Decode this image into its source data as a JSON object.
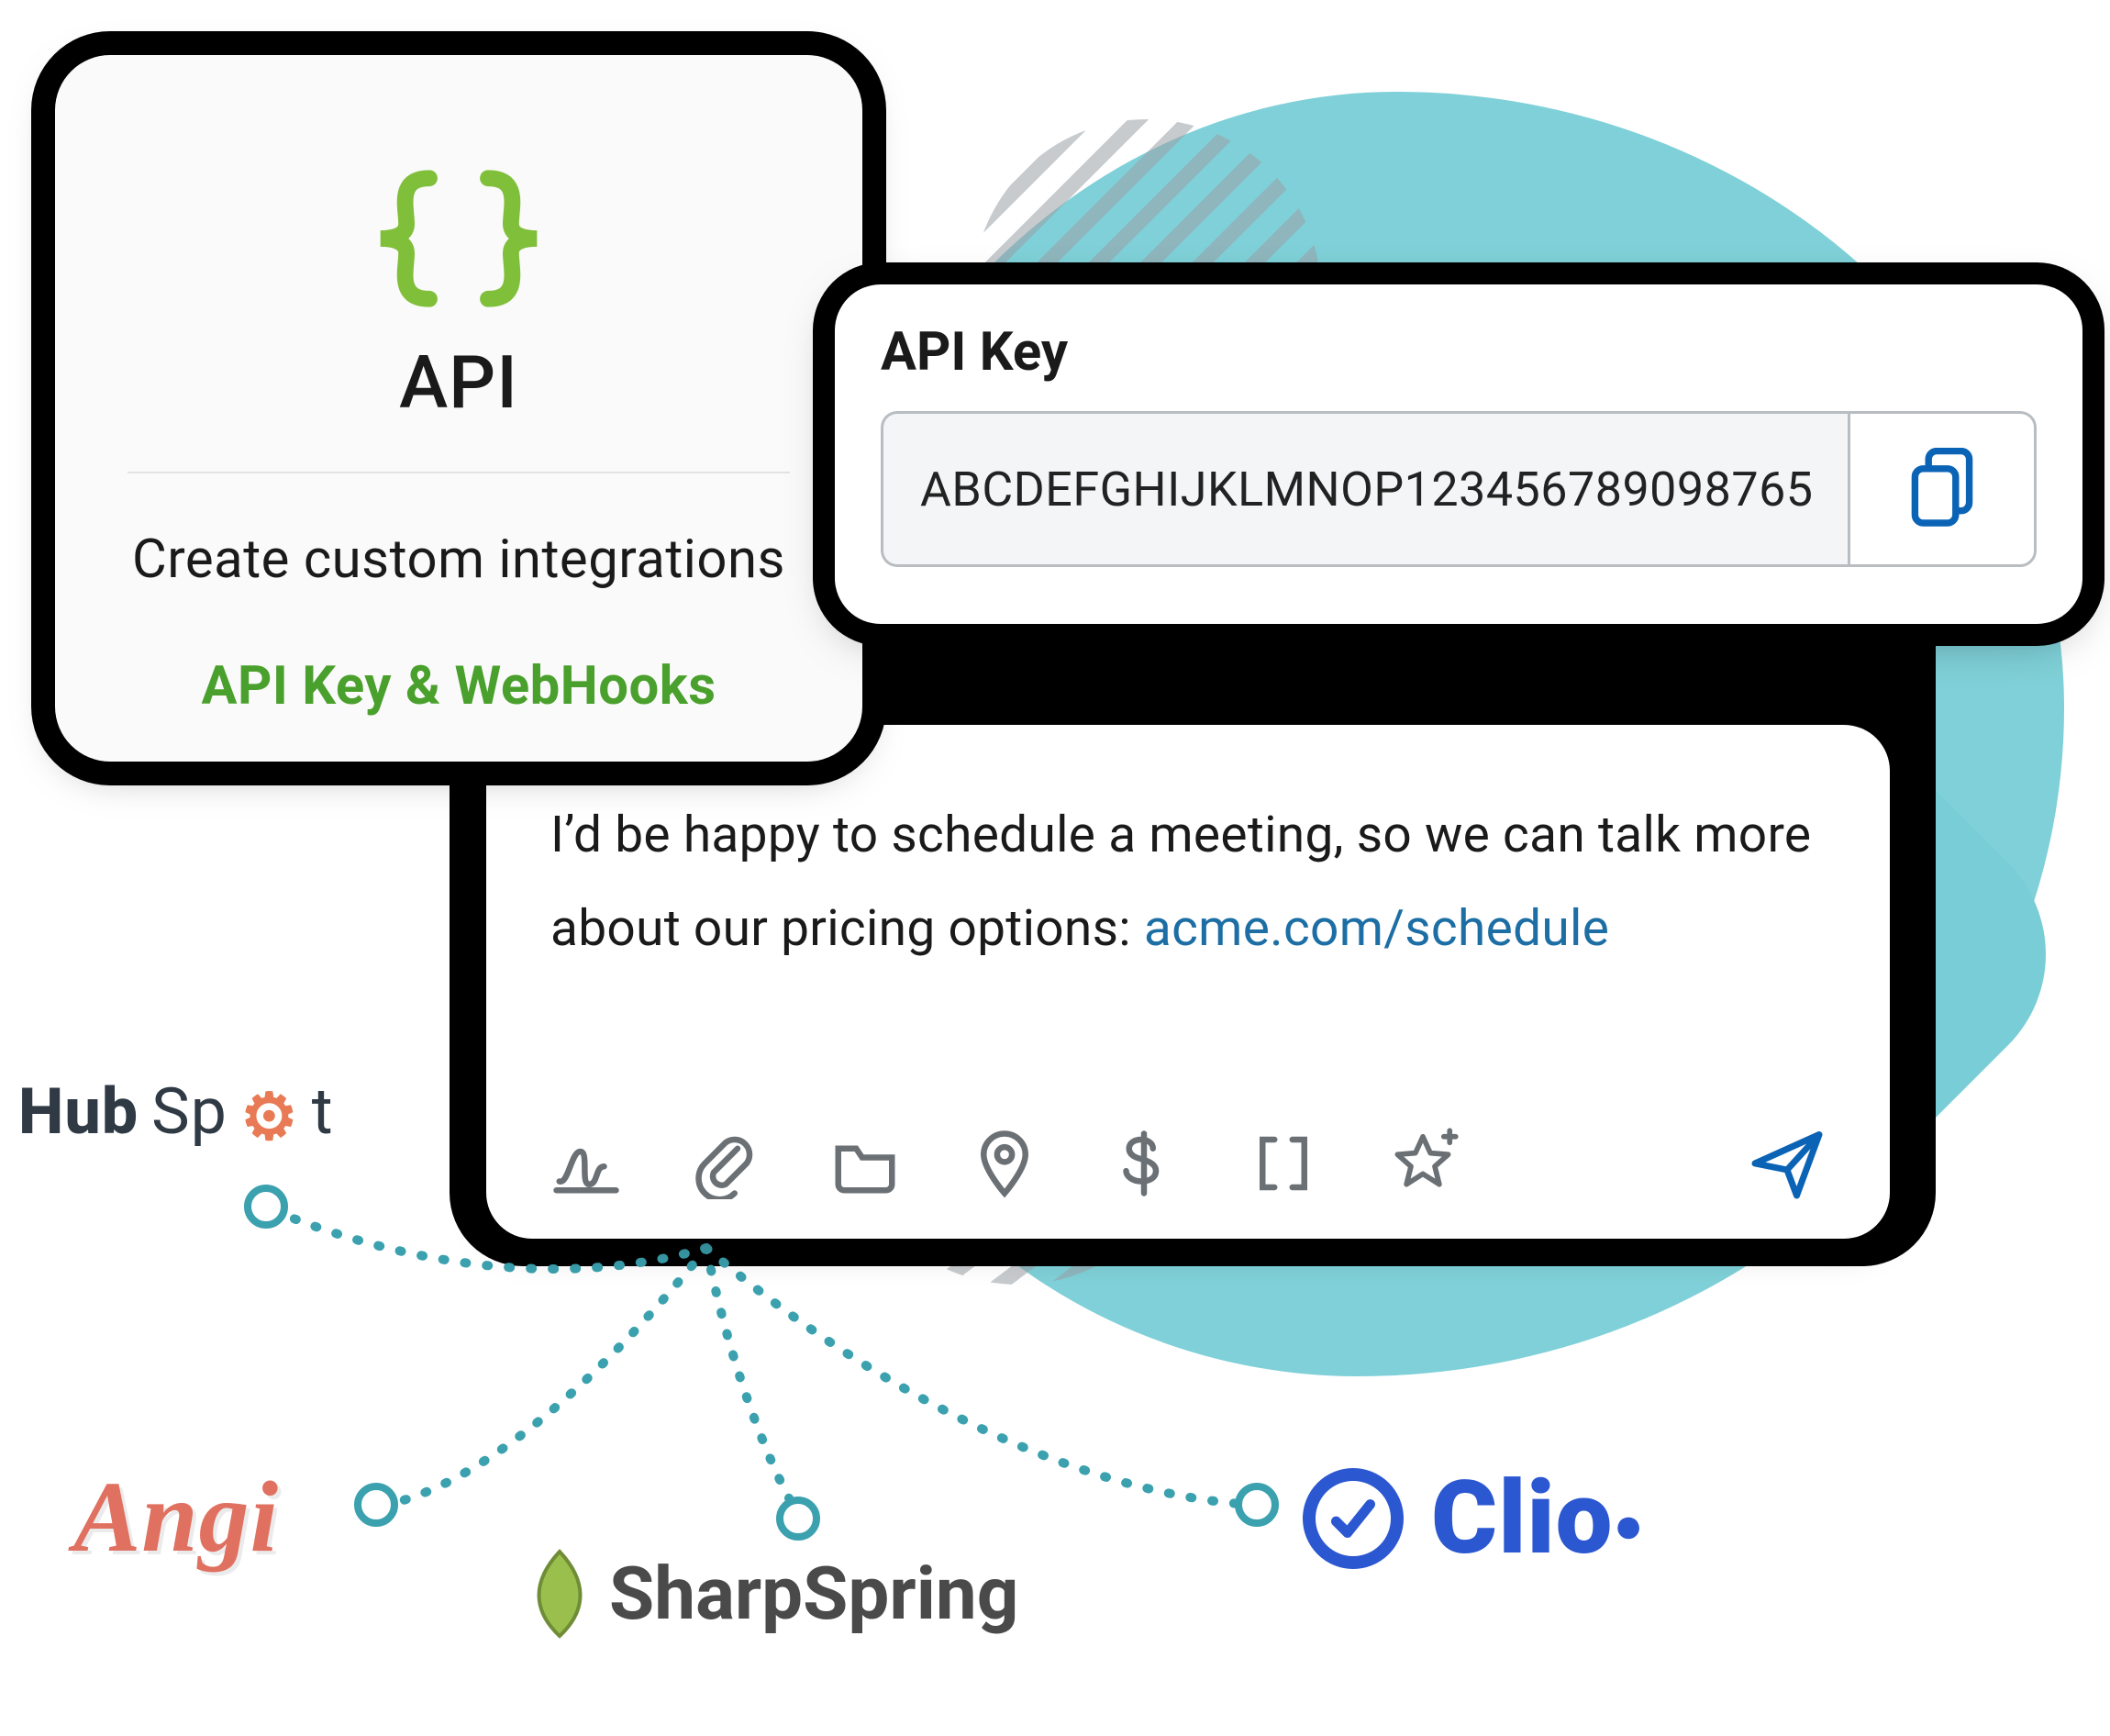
{
  "api_card": {
    "title": "API",
    "subtitle": "Create custom integrations",
    "link_text": "API Key & WebHooks"
  },
  "apikey_panel": {
    "label": "API Key",
    "value": "ABCDEFGHIJKLMNOP123456789098765"
  },
  "message": {
    "body_prefix": "I’d be happy to schedule a meeting, so we can talk more about our pricing options: ",
    "link_text": "acme.com/schedule"
  },
  "toolbar_icons": {
    "signature": "signature-icon",
    "attach": "paperclip-icon",
    "folder": "folder-icon",
    "location": "location-pin-icon",
    "dollar": "dollar-icon",
    "brackets": "brackets-icon",
    "star": "star-plus-icon",
    "send": "send-icon"
  },
  "integrations": {
    "hubspot": "HubSpot",
    "angi": "Angi",
    "sharpspring": "SharpSpring",
    "clio": "Clio"
  },
  "colors": {
    "accent_green": "#4aa02c",
    "teal": "#78cdd6",
    "link_blue": "#1c6ea4",
    "send_blue": "#0b63b5"
  }
}
